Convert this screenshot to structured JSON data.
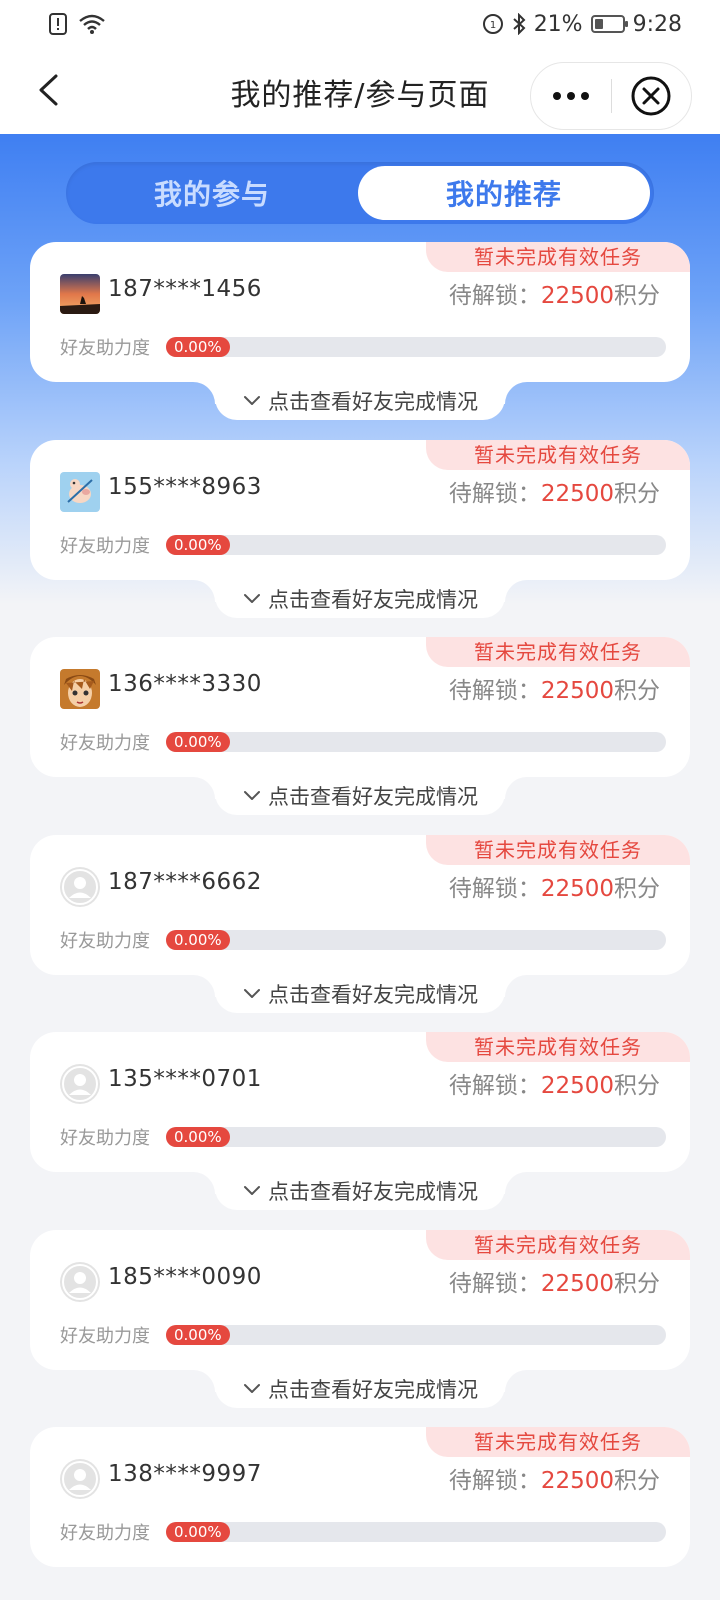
{
  "status_bar": {
    "battery": "21%",
    "time": "9:28"
  },
  "nav": {
    "title": "我的推荐/参与页面"
  },
  "tabs": [
    {
      "label": "我的参与",
      "active": false
    },
    {
      "label": "我的推荐",
      "active": true
    }
  ],
  "cards": [
    {
      "phone": "187****1456",
      "badge": "暂未完成有效任务",
      "unlock_label": "待解锁：",
      "unlock_points": "22500",
      "unlock_unit": "积分",
      "help_label": "好友助力度",
      "progress": "0.00%",
      "expand_label": "点击查看好友完成情况",
      "avatar": "sunset-photo"
    },
    {
      "phone": "155****8963",
      "badge": "暂未完成有效任务",
      "unlock_label": "待解锁：",
      "unlock_points": "22500",
      "unlock_unit": "积分",
      "help_label": "好友助力度",
      "progress": "0.00%",
      "expand_label": "点击查看好友完成情况",
      "avatar": "cartoon-pig"
    },
    {
      "phone": "136****3330",
      "badge": "暂未完成有效任务",
      "unlock_label": "待解锁：",
      "unlock_points": "22500",
      "unlock_unit": "积分",
      "help_label": "好友助力度",
      "progress": "0.00%",
      "expand_label": "点击查看好友完成情况",
      "avatar": "anime-face"
    },
    {
      "phone": "187****6662",
      "badge": "暂未完成有效任务",
      "unlock_label": "待解锁：",
      "unlock_points": "22500",
      "unlock_unit": "积分",
      "help_label": "好友助力度",
      "progress": "0.00%",
      "expand_label": "点击查看好友完成情况",
      "avatar": "default"
    },
    {
      "phone": "135****0701",
      "badge": "暂未完成有效任务",
      "unlock_label": "待解锁：",
      "unlock_points": "22500",
      "unlock_unit": "积分",
      "help_label": "好友助力度",
      "progress": "0.00%",
      "expand_label": "点击查看好友完成情况",
      "avatar": "default"
    },
    {
      "phone": "185****0090",
      "badge": "暂未完成有效任务",
      "unlock_label": "待解锁：",
      "unlock_points": "22500",
      "unlock_unit": "积分",
      "help_label": "好友助力度",
      "progress": "0.00%",
      "expand_label": "点击查看好友完成情况",
      "avatar": "default"
    },
    {
      "phone": "138****9997",
      "badge": "暂未完成有效任务",
      "unlock_label": "待解锁：",
      "unlock_points": "22500",
      "unlock_unit": "积分",
      "help_label": "好友助力度",
      "progress": "0.00%",
      "expand_label": "",
      "avatar": "default"
    }
  ],
  "colors": {
    "accent_blue": "#3d79ec",
    "accent_red": "#e5483f",
    "badge_bg": "#fde2e2"
  }
}
